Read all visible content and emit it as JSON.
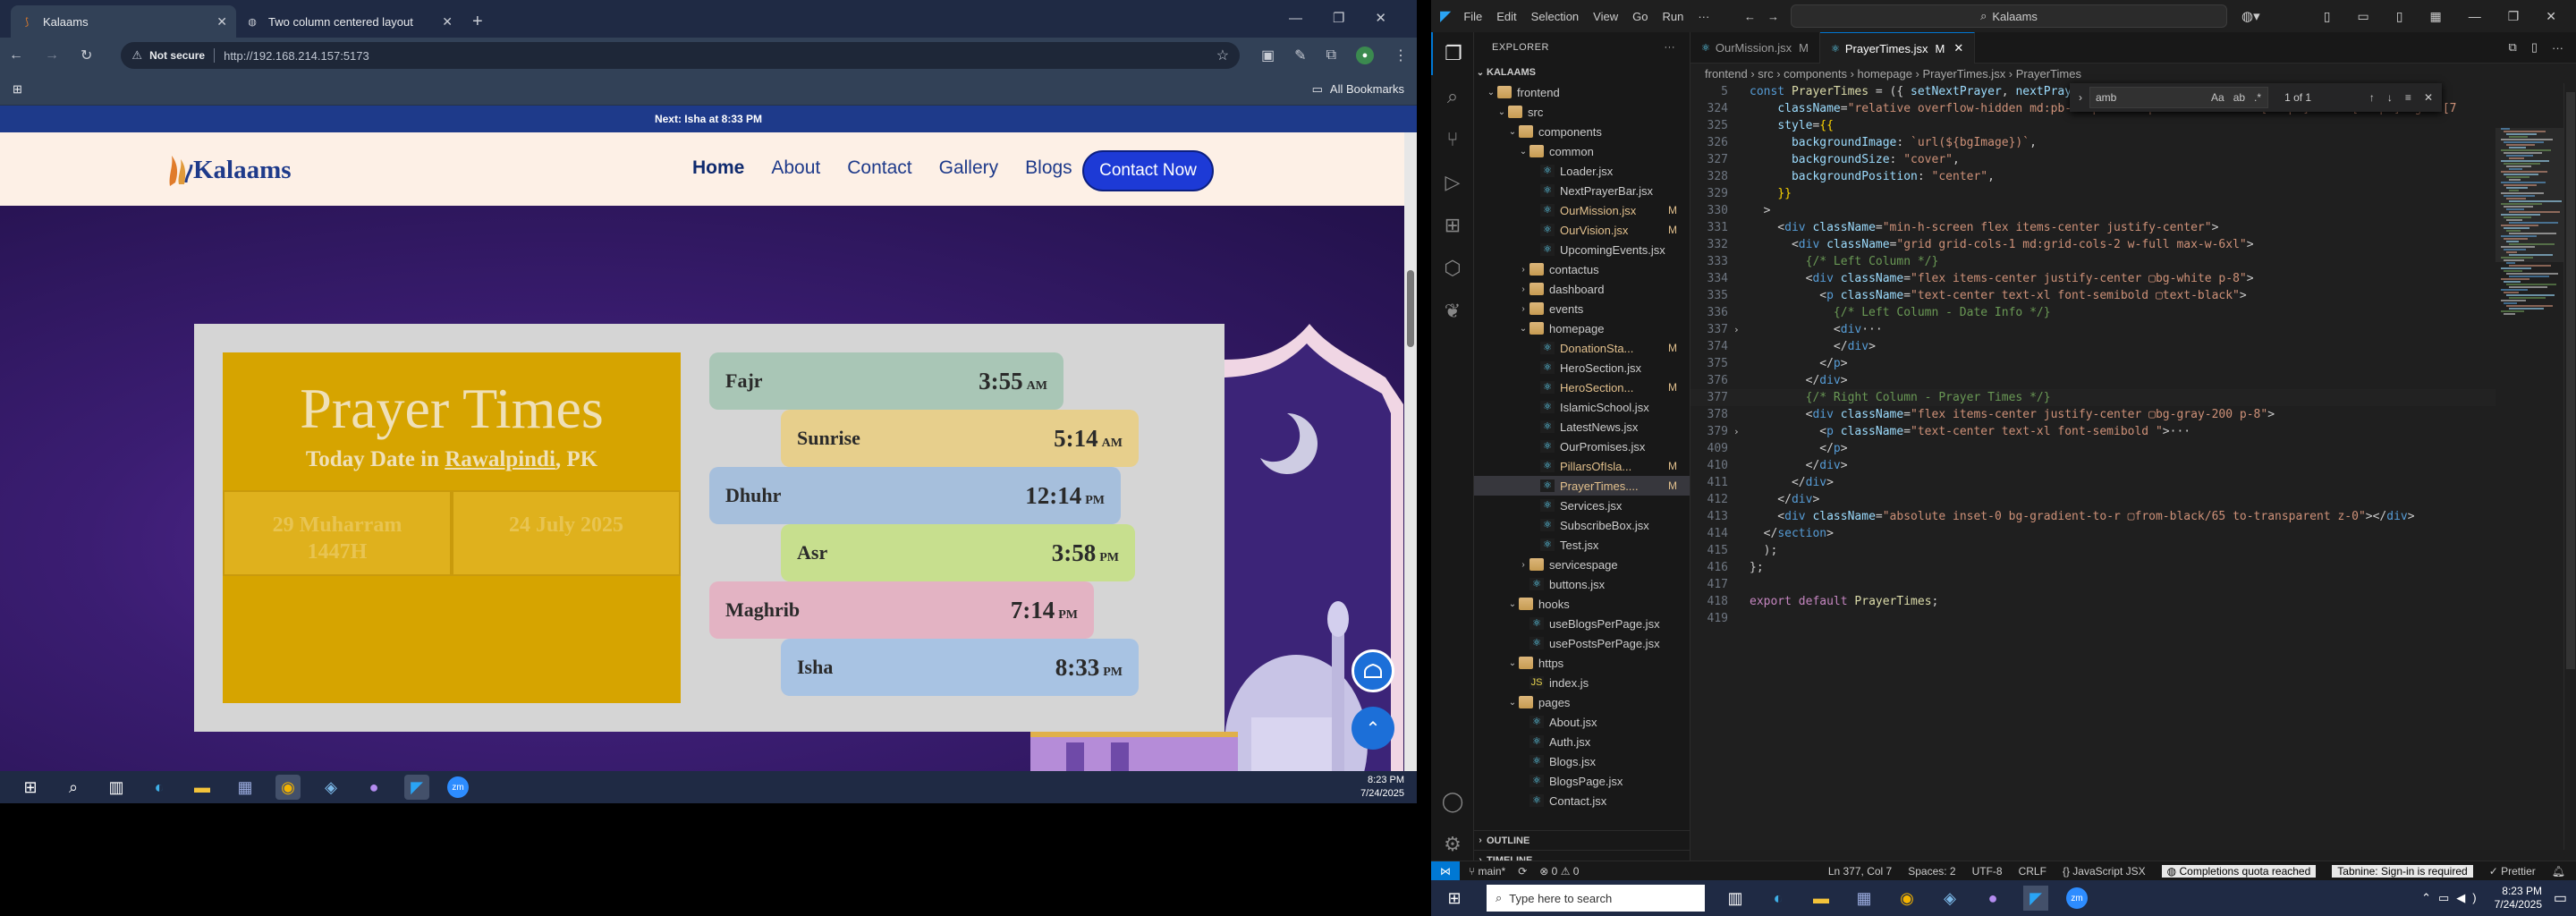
{
  "browser": {
    "tabs": [
      {
        "label": "Kalaams",
        "active": true
      },
      {
        "label": "Two column centered layout",
        "active": false
      }
    ],
    "not_secure": "Not secure",
    "url": "http://192.168.214.157:5173",
    "all_bookmarks": "All Bookmarks"
  },
  "site": {
    "next_prayer_bar": "Next: Isha at 8:33 PM",
    "logo_text": "Kalaams",
    "nav": [
      "Home",
      "About",
      "Contact",
      "Gallery",
      "Blogs"
    ],
    "contact_button": "Contact Now",
    "prayer_title": "Prayer Times",
    "today_prefix": "Today Date in",
    "city": "Rawalpindi",
    "country": ", PK",
    "hijri_date_line1": "29 Muharram",
    "hijri_date_line2": "1447H",
    "greg_date": "24 July 2025",
    "prayers": [
      {
        "name": "Fajr",
        "time": "3:55",
        "ampm": "AM",
        "color": "#a9c6b6"
      },
      {
        "name": "Sunrise",
        "time": "5:14",
        "ampm": "AM",
        "color": "#e7cf8c"
      },
      {
        "name": "Dhuhr",
        "time": "12:14",
        "ampm": "PM",
        "color": "#a6bfdc"
      },
      {
        "name": "Asr",
        "time": "3:58",
        "ampm": "PM",
        "color": "#c7df8e"
      },
      {
        "name": "Maghrib",
        "time": "7:14",
        "ampm": "PM",
        "color": "#e3b3c3"
      },
      {
        "name": "Isha",
        "time": "8:33",
        "ampm": "PM",
        "color": "#a8c3e3"
      }
    ]
  },
  "taskbar_left": {
    "time": "8:23 PM",
    "date": "7/24/2025"
  },
  "vscode": {
    "menu": [
      "File",
      "Edit",
      "Selection",
      "View",
      "Go",
      "Run",
      "···"
    ],
    "search": "Kalaams",
    "explorer_title": "EXPLORER",
    "root": "KALAAMS",
    "tree": [
      {
        "label": "frontend",
        "depth": 1,
        "type": "folder",
        "open": true,
        "status": ""
      },
      {
        "label": "src",
        "depth": 2,
        "type": "folder",
        "open": true,
        "status": ""
      },
      {
        "label": "components",
        "depth": 3,
        "type": "folder",
        "open": true,
        "status": ""
      },
      {
        "label": "common",
        "depth": 4,
        "type": "folder",
        "open": true,
        "status": ""
      },
      {
        "label": "Loader.jsx",
        "depth": 5,
        "type": "file",
        "status": ""
      },
      {
        "label": "NextPrayerBar.jsx",
        "depth": 5,
        "type": "file",
        "status": ""
      },
      {
        "label": "OurMission.jsx",
        "depth": 5,
        "type": "file",
        "status": "M"
      },
      {
        "label": "OurVision.jsx",
        "depth": 5,
        "type": "file",
        "status": "M"
      },
      {
        "label": "UpcomingEvents.jsx",
        "depth": 5,
        "type": "file",
        "status": ""
      },
      {
        "label": "contactus",
        "depth": 4,
        "type": "folder",
        "open": false,
        "status": ""
      },
      {
        "label": "dashboard",
        "depth": 4,
        "type": "folder",
        "open": false,
        "status": ""
      },
      {
        "label": "events",
        "depth": 4,
        "type": "folder",
        "open": false,
        "status": ""
      },
      {
        "label": "homepage",
        "depth": 4,
        "type": "folder",
        "open": true,
        "status": ""
      },
      {
        "label": "DonationSta...",
        "depth": 5,
        "type": "file",
        "status": "M"
      },
      {
        "label": "HeroSection.jsx",
        "depth": 5,
        "type": "file",
        "status": ""
      },
      {
        "label": "HeroSection...",
        "depth": 5,
        "type": "file",
        "status": "M"
      },
      {
        "label": "IslamicSchool.jsx",
        "depth": 5,
        "type": "file",
        "status": ""
      },
      {
        "label": "LatestNews.jsx",
        "depth": 5,
        "type": "file",
        "status": ""
      },
      {
        "label": "OurPromises.jsx",
        "depth": 5,
        "type": "file",
        "status": ""
      },
      {
        "label": "PillarsOfIsla...",
        "depth": 5,
        "type": "file",
        "status": "M"
      },
      {
        "label": "PrayerTimes....",
        "depth": 5,
        "type": "file",
        "status": "M",
        "selected": true
      },
      {
        "label": "Services.jsx",
        "depth": 5,
        "type": "file",
        "status": ""
      },
      {
        "label": "SubscribeBox.jsx",
        "depth": 5,
        "type": "file",
        "status": ""
      },
      {
        "label": "Test.jsx",
        "depth": 5,
        "type": "file",
        "status": ""
      },
      {
        "label": "servicespage",
        "depth": 4,
        "type": "folder",
        "open": false,
        "status": ""
      },
      {
        "label": "buttons.jsx",
        "depth": 4,
        "type": "file",
        "status": ""
      },
      {
        "label": "hooks",
        "depth": 3,
        "type": "folder",
        "open": true,
        "status": ""
      },
      {
        "label": "useBlogsPerPage.jsx",
        "depth": 4,
        "type": "file",
        "status": ""
      },
      {
        "label": "usePostsPerPage.jsx",
        "depth": 4,
        "type": "file",
        "status": ""
      },
      {
        "label": "https",
        "depth": 3,
        "type": "folder",
        "open": true,
        "status": ""
      },
      {
        "label": "index.js",
        "depth": 4,
        "type": "file",
        "status": ""
      },
      {
        "label": "pages",
        "depth": 3,
        "type": "folder",
        "open": true,
        "status": ""
      },
      {
        "label": "About.jsx",
        "depth": 4,
        "type": "file",
        "status": ""
      },
      {
        "label": "Auth.jsx",
        "depth": 4,
        "type": "file",
        "status": ""
      },
      {
        "label": "Blogs.jsx",
        "depth": 4,
        "type": "file",
        "status": ""
      },
      {
        "label": "BlogsPage.jsx",
        "depth": 4,
        "type": "file",
        "status": ""
      },
      {
        "label": "Contact.jsx",
        "depth": 4,
        "type": "file",
        "status": ""
      }
    ],
    "outline": "OUTLINE",
    "timeline": "TIMELINE",
    "editor_tabs": [
      {
        "label": "OurMission.jsx",
        "mod": "M",
        "active": false
      },
      {
        "label": "PrayerTimes.jsx",
        "mod": "M",
        "active": true
      }
    ],
    "breadcrumb": "frontend › src › components › homepage › PrayerTimes.jsx › PrayerTimes",
    "find": {
      "query": "amb",
      "count": "1 of 1"
    },
    "status": {
      "branch": "main*",
      "problems": "⊗ 0 ⚠ 0",
      "position": "Ln 377, Col 7",
      "spaces": "Spaces: 2",
      "encoding": "UTF-8",
      "eol": "CRLF",
      "lang": "JavaScript JSX",
      "quota": "Completions quota reached",
      "tabnine": "Tabnine: Sign-in is required",
      "prettier": "✓ Prettier"
    }
  },
  "taskbar_right": {
    "search_placeholder": "Type here to search",
    "time": "8:23 PM",
    "date": "7/24/2025"
  }
}
